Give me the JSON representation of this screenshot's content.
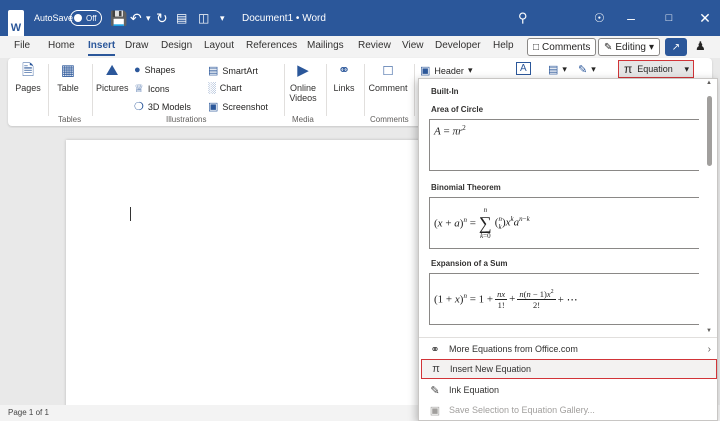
{
  "titlebar": {
    "app_logo": "W",
    "autosave_label": "AutoSave",
    "autosave_state": "Off",
    "doc_title": "Document1  •  Word",
    "icons": [
      "save-icon",
      "undo-icon",
      "redo-icon",
      "print-icon",
      "customize-icon",
      "search-icon",
      "lightbulb-icon",
      "minimize-icon",
      "maximize-icon",
      "close-icon"
    ]
  },
  "menu": {
    "tabs": [
      "File",
      "Home",
      "Insert",
      "Draw",
      "Design",
      "Layout",
      "References",
      "Mailings",
      "Review",
      "View",
      "Developer",
      "Help"
    ],
    "active_tab": "Insert",
    "comments_label": "Comments",
    "editing_label": "Editing"
  },
  "ribbon": {
    "pages_label": "Pages",
    "table_label": "Table",
    "tables_group": "Tables",
    "pictures_label": "Pictures",
    "shapes_label": "Shapes",
    "icons_label": "Icons",
    "models_label": "3D Models",
    "smartart_label": "SmartArt",
    "chart_label": "Chart",
    "screenshot_label": "Screenshot",
    "illustrations_group": "Illustrations",
    "online_videos_line1": "Online",
    "online_videos_line2": "Videos",
    "media_group": "Media",
    "links_label": "Links",
    "comment_label": "Comment",
    "comments_group": "Comments",
    "header_label": "Header",
    "equation_label": "Equation"
  },
  "dropdown": {
    "section_title": "Built-In",
    "equations": [
      {
        "name": "Area of Circle"
      },
      {
        "name": "Binomial Theorem"
      },
      {
        "name": "Expansion of a Sum"
      }
    ],
    "items": [
      {
        "label": "More Equations from Office.com",
        "icon": "office-globe-icon"
      },
      {
        "label": "Insert New Equation",
        "icon": "pi-icon"
      },
      {
        "label": "Ink Equation",
        "icon": "ink-equation-icon"
      },
      {
        "label": "Save Selection to Equation Gallery...",
        "icon": "save-gallery-icon"
      }
    ]
  },
  "status": {
    "page_info": "Page 1 of 1"
  },
  "colors": {
    "titlebar": "#2b579a",
    "highlight": "#d13438"
  }
}
